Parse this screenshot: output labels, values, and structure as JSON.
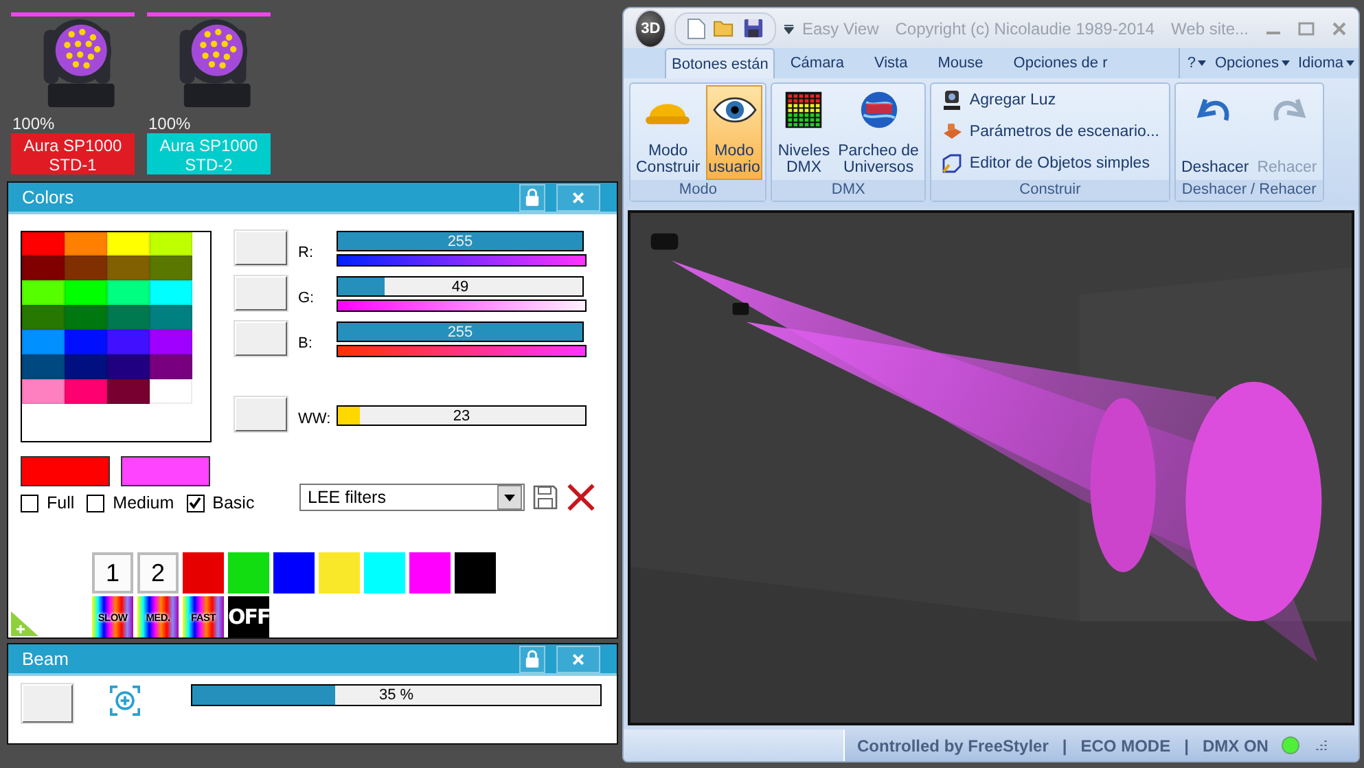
{
  "fixtures": [
    {
      "intensity": "100%",
      "name": "Aura SP1000 STD-1",
      "color": "#e01b24"
    },
    {
      "intensity": "100%",
      "name": "Aura SP1000 STD-2",
      "color": "#00cccc"
    }
  ],
  "colors_panel": {
    "title": "Colors",
    "palette": [
      {
        "color": "#ff0000"
      },
      {
        "color": "#ff8000"
      },
      {
        "color": "#ffff00"
      },
      {
        "color": "#bfff00"
      },
      {
        "color": "#800000"
      },
      {
        "color": "#803000"
      },
      {
        "color": "#806000"
      },
      {
        "color": "#5a7800"
      },
      {
        "color": "#55ff00"
      },
      {
        "color": "#00ff00"
      },
      {
        "color": "#00ff80"
      },
      {
        "color": "#00ffff"
      },
      {
        "color": "#267800"
      },
      {
        "color": "#007810"
      },
      {
        "color": "#007850"
      },
      {
        "color": "#008080"
      },
      {
        "color": "#0090ff"
      },
      {
        "color": "#0010ff"
      },
      {
        "color": "#4010ff"
      },
      {
        "color": "#a000ff"
      },
      {
        "color": "#004880"
      },
      {
        "color": "#001080"
      },
      {
        "color": "#200080"
      },
      {
        "color": "#780080"
      },
      {
        "color": "#ff80c0"
      },
      {
        "color": "#ff0070"
      },
      {
        "color": "#780030"
      },
      {
        "color": "#ffffff"
      }
    ],
    "channels": [
      {
        "label": "R:",
        "reading": "255",
        "level": 1,
        "kind": "rgb"
      },
      {
        "label": "G:",
        "reading": "49",
        "level": 0.19,
        "kind": "rgb"
      },
      {
        "label": "B:",
        "reading": "255",
        "level": 1,
        "kind": "rgb"
      },
      {
        "label": "WW:",
        "reading": "23",
        "level": 0.09,
        "kind": "white"
      }
    ],
    "swatches": [
      {
        "color": "#ff0000"
      },
      {
        "color": "#ff44ff"
      }
    ],
    "palette_sets": [
      {
        "label": "Full",
        "checked": false
      },
      {
        "label": "Medium",
        "checked": false
      },
      {
        "label": "Basic",
        "checked": true
      }
    ],
    "filter": {
      "value": "LEE filters"
    },
    "macros": [
      {
        "kind": "number",
        "label": "1"
      },
      {
        "kind": "number",
        "label": "2"
      },
      {
        "kind": "color",
        "color": "#e60000"
      },
      {
        "kind": "color",
        "color": "#11dd11"
      },
      {
        "kind": "color",
        "color": "#0000ff"
      },
      {
        "kind": "color",
        "color": "#f9e829"
      },
      {
        "kind": "color",
        "color": "#00ffff"
      },
      {
        "kind": "color",
        "color": "#ff00ff"
      },
      {
        "kind": "color",
        "color": "#000000"
      },
      {
        "kind": "rainbow",
        "label": "SLOW"
      },
      {
        "kind": "rainbow",
        "label": "MED."
      },
      {
        "kind": "rainbow",
        "label": "FAST"
      },
      {
        "kind": "off",
        "label": "OFF"
      }
    ]
  },
  "beam_panel": {
    "title": "Beam",
    "level": 0.35,
    "reading": "35 %"
  },
  "window": {
    "logo": "3D",
    "title_parts": [
      "Easy View",
      "Copyright (c) Nicolaudie 1989-2014",
      "Web site..."
    ]
  },
  "tabs": [
    {
      "label": "Botones están",
      "selected": true
    },
    {
      "label": "Cámara",
      "selected": false
    },
    {
      "label": "Vista",
      "selected": false
    },
    {
      "label": "Mouse",
      "selected": false
    },
    {
      "label": "Opciones de r",
      "selected": false
    }
  ],
  "menus": [
    {
      "label": "?"
    },
    {
      "label": "Opciones"
    },
    {
      "label": "Idioma"
    }
  ],
  "ribbon_groups": [
    {
      "label": "Modo",
      "kind": "large",
      "buttons": [
        {
          "lines": [
            "Modo",
            "Construir"
          ],
          "selected": false,
          "disabled": false
        },
        {
          "lines": [
            "Modo",
            "usuario"
          ],
          "selected": true,
          "disabled": false
        }
      ]
    },
    {
      "label": "DMX",
      "kind": "large",
      "buttons": [
        {
          "lines": [
            "Niveles",
            "DMX"
          ],
          "selected": false,
          "disabled": false
        },
        {
          "lines": [
            "Parcheo de",
            "Universos"
          ],
          "selected": false,
          "disabled": false
        }
      ]
    },
    {
      "label": "Construir",
      "kind": "small",
      "buttons": [
        {
          "lines": [
            "Agregar Luz"
          ],
          "selected": false,
          "disabled": false
        },
        {
          "lines": [
            "Parámetros de escenario..."
          ],
          "selected": false,
          "disabled": false
        },
        {
          "lines": [
            "Editor de Objetos simples"
          ],
          "selected": false,
          "disabled": false
        }
      ]
    },
    {
      "label": "Deshacer / Rehacer",
      "kind": "large",
      "buttons": [
        {
          "lines": [
            "Deshacer"
          ],
          "selected": false,
          "disabled": false
        },
        {
          "lines": [
            "Rehacer"
          ],
          "selected": false,
          "disabled": true
        }
      ]
    }
  ],
  "status_bar": {
    "items": [
      "Controlled by FreeStyler",
      "|",
      "ECO MODE",
      "|",
      "DMX ON"
    ],
    "dmx_on": true
  }
}
